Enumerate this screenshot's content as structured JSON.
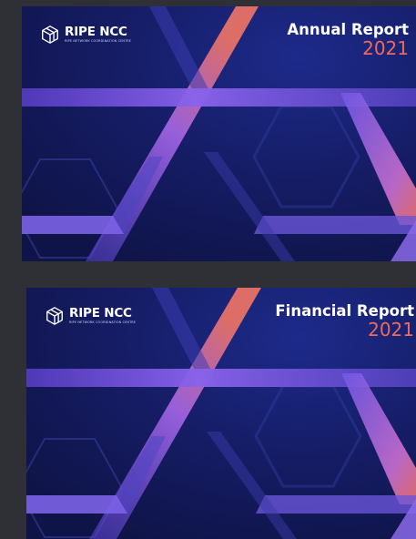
{
  "pages": [
    {
      "brand": "RIPE NCC",
      "tagline": "RIPE NETWORK COORDINATION CENTRE",
      "title": "Annual Report",
      "year": "2021"
    },
    {
      "brand": "RIPE NCC",
      "tagline": "RIPE NETWORK COORDINATION CENTRE",
      "title": "Financial Report",
      "year": "2021"
    }
  ],
  "colors": {
    "viewer_background": "#2e3036",
    "cover_background": "#14195a",
    "accent_year": "#f06a5a",
    "band_violet": "#7a5ce8",
    "band_coral": "#f07068"
  },
  "icons": [
    "ripe-ncc-logo-icon"
  ]
}
